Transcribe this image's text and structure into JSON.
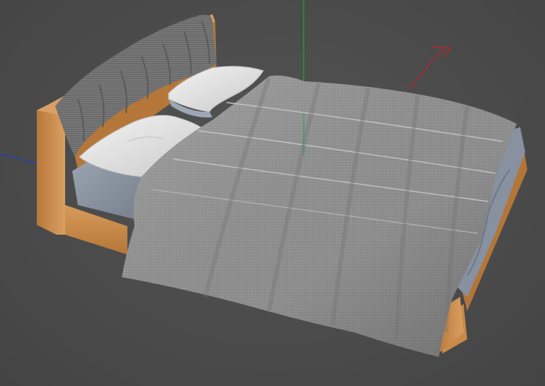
{
  "viewport": {
    "background_color": "#4a4a4a",
    "render_mode": "perspective",
    "object": "bed-model"
  },
  "axes": {
    "x": {
      "color": "#c0202a",
      "icon": "x-axis-arrow-icon"
    },
    "y": {
      "color": "#27a045",
      "icon": "y-axis-line-icon"
    },
    "z": {
      "color": "#2a39c8",
      "icon": "z-axis-line-icon"
    }
  },
  "materials": {
    "wood": "#c98a4a",
    "wood_dark": "#a46a32",
    "sheet": "#8c96a4",
    "pillow": "#e8e8e8",
    "duvet": "#8e8e8e",
    "throw": "#6a6a6a"
  }
}
